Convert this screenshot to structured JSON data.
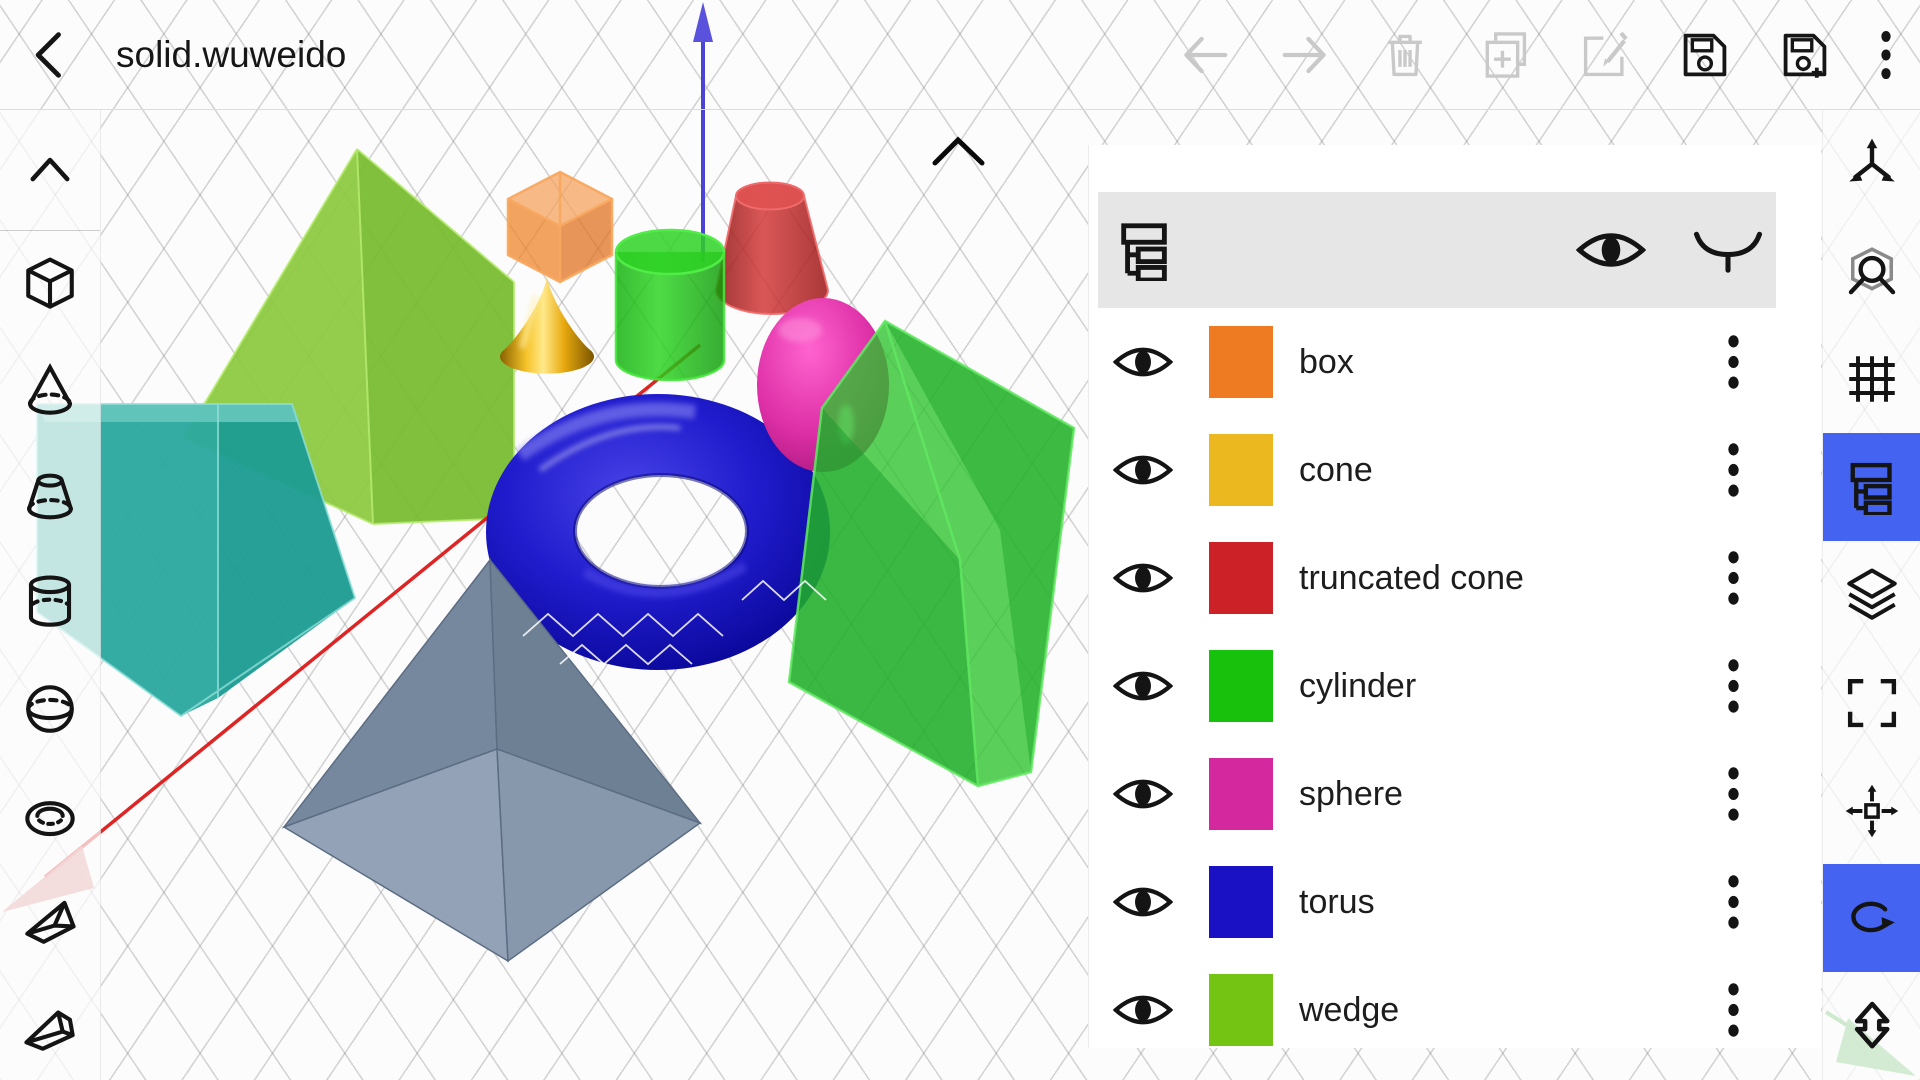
{
  "app": {
    "title": "solid.wuweido"
  },
  "topbar": {
    "back_icon": "back-chevron",
    "actions": [
      {
        "id": "undo",
        "icon": "undo-arrow",
        "enabled": false
      },
      {
        "id": "redo",
        "icon": "redo-arrow",
        "enabled": false
      },
      {
        "id": "delete",
        "icon": "trash-icon",
        "enabled": false
      },
      {
        "id": "duplicate",
        "icon": "duplicate-icon",
        "enabled": false
      },
      {
        "id": "edit",
        "icon": "edit-pencil-icon",
        "enabled": false
      },
      {
        "id": "save",
        "icon": "save-floppy-icon",
        "enabled": true
      },
      {
        "id": "save_as",
        "icon": "save-as-floppy-plus-icon",
        "enabled": true
      },
      {
        "id": "menu",
        "icon": "kebab-menu-icon",
        "enabled": true
      }
    ]
  },
  "left_toolbar": {
    "items": [
      {
        "id": "collapse",
        "icon": "chevron-up-icon"
      },
      {
        "id": "box",
        "icon": "cube-outline-icon"
      },
      {
        "id": "cone",
        "icon": "cone-outline-icon"
      },
      {
        "id": "truncated_cone",
        "icon": "frustum-outline-icon"
      },
      {
        "id": "cylinder",
        "icon": "cylinder-outline-icon"
      },
      {
        "id": "sphere",
        "icon": "sphere-outline-icon"
      },
      {
        "id": "torus",
        "icon": "torus-outline-icon"
      },
      {
        "id": "prism",
        "icon": "prism-outline-icon"
      },
      {
        "id": "wedge",
        "icon": "wedge-outline-icon"
      }
    ]
  },
  "right_toolbar": {
    "active_color": "#4463f0",
    "items": [
      {
        "id": "axes",
        "icon": "axis-tripod-icon",
        "active": false
      },
      {
        "id": "view_cube",
        "icon": "cube-magnifier-icon",
        "active": false
      },
      {
        "id": "grid",
        "icon": "grid-icon",
        "active": false
      },
      {
        "id": "structure",
        "icon": "tree-view-icon",
        "active": true
      },
      {
        "id": "layers",
        "icon": "layers-icon",
        "active": false
      },
      {
        "id": "selection",
        "icon": "frame-brackets-icon",
        "active": false
      },
      {
        "id": "move",
        "icon": "move-arrows-icon",
        "active": false
      },
      {
        "id": "rotate",
        "icon": "rotate-arrow-icon",
        "active": true
      },
      {
        "id": "mirror",
        "icon": "double-arrow-icon",
        "active": false
      }
    ]
  },
  "panel": {
    "header": {
      "tree_icon": "tree-view-icon",
      "show_all_icon": "eye-open-icon",
      "hide_all_icon": "eye-closed-icon"
    },
    "objects": [
      {
        "label": "box",
        "color": "#ee7b22",
        "visible": true
      },
      {
        "label": "cone",
        "color": "#ecb820",
        "visible": true
      },
      {
        "label": "truncated cone",
        "color": "#cb2127",
        "visible": true
      },
      {
        "label": "cylinder",
        "color": "#17c10c",
        "visible": true
      },
      {
        "label": "sphere",
        "color": "#d3289e",
        "visible": true
      },
      {
        "label": "torus",
        "color": "#1a10c4",
        "visible": true
      },
      {
        "label": "wedge",
        "color": "#74c413",
        "visible": true
      }
    ]
  },
  "scene": {
    "handle_icon": "chevron-expander",
    "axes": {
      "x_color": "#dc1a1a",
      "y_color": "#57b757",
      "z_color": "#4a43d6"
    },
    "shapes": {
      "wedge_left": "#8cc93e",
      "box": "#ee8124",
      "cone_gold": "#e8a90f",
      "cylinder": "#17c10c",
      "truncated_cone": "#c62525",
      "sphere": "#d3289e",
      "torus": "#1a14c4",
      "wedge_right": "#2cc32c",
      "prism_teal": "#2aa89e",
      "pyramid": "#8496ab"
    }
  }
}
